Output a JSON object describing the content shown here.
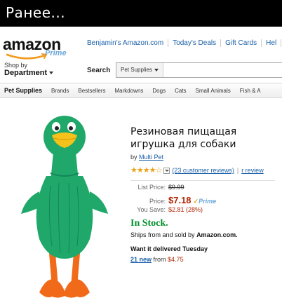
{
  "caption": "Ранее...",
  "header": {
    "logo_text": "amazon",
    "logo_sub": "Prime",
    "top_links": [
      "Benjamin's Amazon.com",
      "Today's Deals",
      "Gift Cards",
      "Hel"
    ],
    "shop_by_small": "Shop by",
    "shop_by_big": "Department",
    "search_label": "Search",
    "search_category": "Pet Supplies",
    "search_value": ""
  },
  "category_bar": [
    "Pet Supplies",
    "Brands",
    "Bestsellers",
    "Markdowns",
    "Dogs",
    "Cats",
    "Small Animals",
    "Fish & A"
  ],
  "product": {
    "title": "Резиновая пищащая игрушка для собаки",
    "by_label": "by",
    "brand": "Multi Pet",
    "rating_stars": 4.5,
    "stars_glyphs": "★★★★☆",
    "reviews": "(23 customer reviews)",
    "review_link_partial": "r review",
    "list_price_label": "List Price:",
    "list_price": "$9.99",
    "price_label": "Price:",
    "price": "$7.18",
    "prime_label": "Prime",
    "save_label": "You Save:",
    "save_value": "$2.81 (28%)",
    "stock": "In Stock.",
    "ships_prefix": "Ships from and sold by",
    "ships_seller": "Amazon.com.",
    "ships_suffix": "",
    "delivery": "Want it delivered Tuesday",
    "new_count": "21 new",
    "new_from": "from",
    "new_price": "$4.75"
  },
  "colors": {
    "caption_bg": "#000000",
    "link": "#1a5fa8",
    "price": "#b12704",
    "in_stock": "#00902c",
    "toy_green": "#1fa86a",
    "toy_orange": "#f06a1a"
  }
}
